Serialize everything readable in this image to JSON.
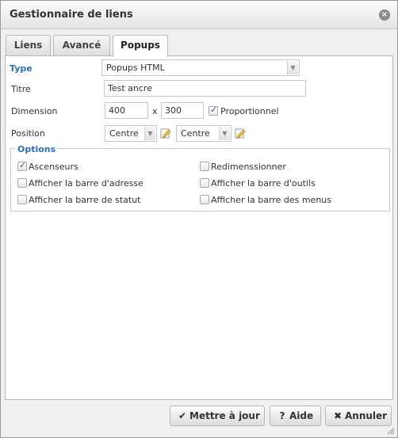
{
  "dialog": {
    "title": "Gestionnaire de liens",
    "close_glyph": "×"
  },
  "tabs": [
    {
      "label": "Liens"
    },
    {
      "label": "Avancé"
    },
    {
      "label": "Popups",
      "active": true
    }
  ],
  "form": {
    "type_label": "Type",
    "type_value": "Popups HTML",
    "title_label": "Titre",
    "title_value": "Test ancre",
    "dimension_label": "Dimension",
    "width_value": "400",
    "times": "x",
    "height_value": "300",
    "proportional_label": "Proportionnel",
    "proportional_checked": true,
    "position_label": "Position",
    "position_h": "Centre",
    "position_v": "Centre"
  },
  "options": {
    "legend": "Options",
    "items": [
      {
        "label": "Ascenseurs",
        "checked": true
      },
      {
        "label": "Redimenssionner",
        "checked": false
      },
      {
        "label": "Afficher la barre d'adresse",
        "checked": false
      },
      {
        "label": "Afficher la barre d'outils",
        "checked": false
      },
      {
        "label": "Afficher la barre de statut",
        "checked": false
      },
      {
        "label": "Afficher la barre des menus",
        "checked": false
      }
    ]
  },
  "buttons": {
    "update": {
      "label": "Mettre à jour",
      "icon": "check-icon"
    },
    "help": {
      "label": "Aide",
      "icon": "question-icon"
    },
    "cancel": {
      "label": "Annuler",
      "icon": "close-icon"
    }
  },
  "colors": {
    "accent": "#2d6fb8"
  }
}
